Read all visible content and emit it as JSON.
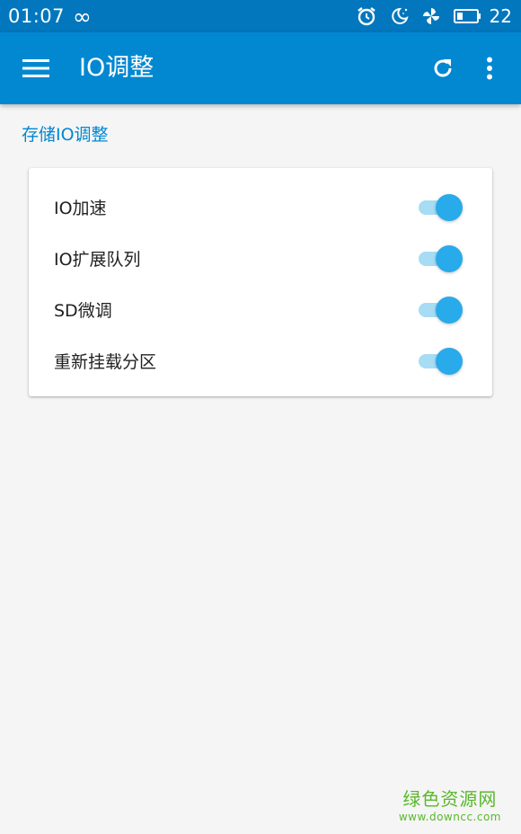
{
  "status_bar": {
    "time": "01:07",
    "infinity_glyph": "∞",
    "icons": [
      "alarm-icon",
      "moon-icon",
      "pinwheel-icon",
      "battery-icon"
    ],
    "battery_level": "22"
  },
  "app_bar": {
    "title": "IO调整",
    "left_icon": "menu-icon",
    "right_icons": [
      "refresh-icon",
      "more-vert-icon"
    ]
  },
  "section": {
    "title": "存储IO调整"
  },
  "settings": [
    {
      "label": "IO加速",
      "enabled": true
    },
    {
      "label": "IO扩展队列",
      "enabled": true
    },
    {
      "label": "SD微调",
      "enabled": true
    },
    {
      "label": "重新挂载分区",
      "enabled": true
    }
  ],
  "watermark": {
    "title": "绿色资源网",
    "url": "www.downcc.com"
  },
  "colors": {
    "status_bar": "#0277bd",
    "app_bar": "#0288d1",
    "accent": "#29aaeb",
    "track": "#a6dcf4",
    "background": "#f5f5f5",
    "watermark": "#59b82c"
  }
}
